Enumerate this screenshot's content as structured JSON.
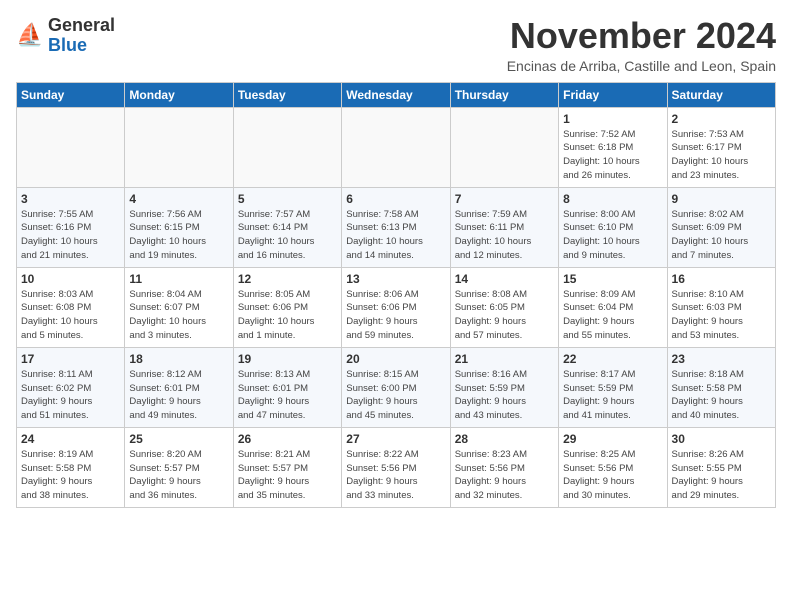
{
  "logo": {
    "general": "General",
    "blue": "Blue"
  },
  "title": "November 2024",
  "subtitle": "Encinas de Arriba, Castille and Leon, Spain",
  "headers": [
    "Sunday",
    "Monday",
    "Tuesday",
    "Wednesday",
    "Thursday",
    "Friday",
    "Saturday"
  ],
  "weeks": [
    [
      {
        "day": "",
        "info": ""
      },
      {
        "day": "",
        "info": ""
      },
      {
        "day": "",
        "info": ""
      },
      {
        "day": "",
        "info": ""
      },
      {
        "day": "",
        "info": ""
      },
      {
        "day": "1",
        "info": "Sunrise: 7:52 AM\nSunset: 6:18 PM\nDaylight: 10 hours\nand 26 minutes."
      },
      {
        "day": "2",
        "info": "Sunrise: 7:53 AM\nSunset: 6:17 PM\nDaylight: 10 hours\nand 23 minutes."
      }
    ],
    [
      {
        "day": "3",
        "info": "Sunrise: 7:55 AM\nSunset: 6:16 PM\nDaylight: 10 hours\nand 21 minutes."
      },
      {
        "day": "4",
        "info": "Sunrise: 7:56 AM\nSunset: 6:15 PM\nDaylight: 10 hours\nand 19 minutes."
      },
      {
        "day": "5",
        "info": "Sunrise: 7:57 AM\nSunset: 6:14 PM\nDaylight: 10 hours\nand 16 minutes."
      },
      {
        "day": "6",
        "info": "Sunrise: 7:58 AM\nSunset: 6:13 PM\nDaylight: 10 hours\nand 14 minutes."
      },
      {
        "day": "7",
        "info": "Sunrise: 7:59 AM\nSunset: 6:11 PM\nDaylight: 10 hours\nand 12 minutes."
      },
      {
        "day": "8",
        "info": "Sunrise: 8:00 AM\nSunset: 6:10 PM\nDaylight: 10 hours\nand 9 minutes."
      },
      {
        "day": "9",
        "info": "Sunrise: 8:02 AM\nSunset: 6:09 PM\nDaylight: 10 hours\nand 7 minutes."
      }
    ],
    [
      {
        "day": "10",
        "info": "Sunrise: 8:03 AM\nSunset: 6:08 PM\nDaylight: 10 hours\nand 5 minutes."
      },
      {
        "day": "11",
        "info": "Sunrise: 8:04 AM\nSunset: 6:07 PM\nDaylight: 10 hours\nand 3 minutes."
      },
      {
        "day": "12",
        "info": "Sunrise: 8:05 AM\nSunset: 6:06 PM\nDaylight: 10 hours\nand 1 minute."
      },
      {
        "day": "13",
        "info": "Sunrise: 8:06 AM\nSunset: 6:06 PM\nDaylight: 9 hours\nand 59 minutes."
      },
      {
        "day": "14",
        "info": "Sunrise: 8:08 AM\nSunset: 6:05 PM\nDaylight: 9 hours\nand 57 minutes."
      },
      {
        "day": "15",
        "info": "Sunrise: 8:09 AM\nSunset: 6:04 PM\nDaylight: 9 hours\nand 55 minutes."
      },
      {
        "day": "16",
        "info": "Sunrise: 8:10 AM\nSunset: 6:03 PM\nDaylight: 9 hours\nand 53 minutes."
      }
    ],
    [
      {
        "day": "17",
        "info": "Sunrise: 8:11 AM\nSunset: 6:02 PM\nDaylight: 9 hours\nand 51 minutes."
      },
      {
        "day": "18",
        "info": "Sunrise: 8:12 AM\nSunset: 6:01 PM\nDaylight: 9 hours\nand 49 minutes."
      },
      {
        "day": "19",
        "info": "Sunrise: 8:13 AM\nSunset: 6:01 PM\nDaylight: 9 hours\nand 47 minutes."
      },
      {
        "day": "20",
        "info": "Sunrise: 8:15 AM\nSunset: 6:00 PM\nDaylight: 9 hours\nand 45 minutes."
      },
      {
        "day": "21",
        "info": "Sunrise: 8:16 AM\nSunset: 5:59 PM\nDaylight: 9 hours\nand 43 minutes."
      },
      {
        "day": "22",
        "info": "Sunrise: 8:17 AM\nSunset: 5:59 PM\nDaylight: 9 hours\nand 41 minutes."
      },
      {
        "day": "23",
        "info": "Sunrise: 8:18 AM\nSunset: 5:58 PM\nDaylight: 9 hours\nand 40 minutes."
      }
    ],
    [
      {
        "day": "24",
        "info": "Sunrise: 8:19 AM\nSunset: 5:58 PM\nDaylight: 9 hours\nand 38 minutes."
      },
      {
        "day": "25",
        "info": "Sunrise: 8:20 AM\nSunset: 5:57 PM\nDaylight: 9 hours\nand 36 minutes."
      },
      {
        "day": "26",
        "info": "Sunrise: 8:21 AM\nSunset: 5:57 PM\nDaylight: 9 hours\nand 35 minutes."
      },
      {
        "day": "27",
        "info": "Sunrise: 8:22 AM\nSunset: 5:56 PM\nDaylight: 9 hours\nand 33 minutes."
      },
      {
        "day": "28",
        "info": "Sunrise: 8:23 AM\nSunset: 5:56 PM\nDaylight: 9 hours\nand 32 minutes."
      },
      {
        "day": "29",
        "info": "Sunrise: 8:25 AM\nSunset: 5:56 PM\nDaylight: 9 hours\nand 30 minutes."
      },
      {
        "day": "30",
        "info": "Sunrise: 8:26 AM\nSunset: 5:55 PM\nDaylight: 9 hours\nand 29 minutes."
      }
    ]
  ]
}
